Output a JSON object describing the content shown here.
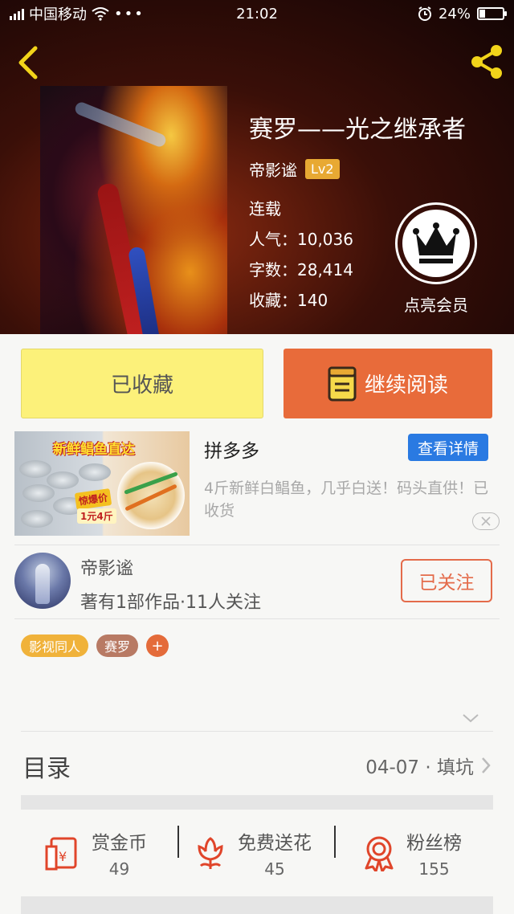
{
  "status_bar": {
    "carrier": "中国移动",
    "time": "21:02",
    "battery": "24%",
    "battery_level": 0.24
  },
  "book": {
    "title": "赛罗——光之继承者",
    "author": "帝影谧",
    "level": "Lv2",
    "status": "连载",
    "popularity_label": "人气：",
    "popularity": "10,036",
    "words_label": "字数：",
    "words": "28,414",
    "favorites_label": "收藏：",
    "favorites": "140"
  },
  "member": {
    "label": "点亮会员"
  },
  "actions": {
    "collected_label": "已收藏",
    "continue_label": "继续阅读"
  },
  "ad": {
    "image_title": "新鲜鲳鱼直达",
    "image_tag": "惊爆价",
    "image_price": "1元4斤",
    "title": "拼多多",
    "button": "查看详情",
    "description": "4斤新鲜白鲳鱼，几乎白送！码头直供！已收货"
  },
  "author_card": {
    "name": "帝影谧",
    "stats": "著有1部作品·11人关注",
    "follow_label": "已关注"
  },
  "tags": [
    {
      "label": "影视同人",
      "color": "#f0b23a"
    },
    {
      "label": "赛罗",
      "color": "#b87a64"
    }
  ],
  "tag_add": "+",
  "toc": {
    "label": "目录",
    "latest": "04-07 · 填坑"
  },
  "stats": [
    {
      "label": "赏金币",
      "value": "49",
      "icon": "red-envelope-icon"
    },
    {
      "label": "免费送花",
      "value": "45",
      "icon": "flower-icon"
    },
    {
      "label": "粉丝榜",
      "value": "155",
      "icon": "medal-icon"
    }
  ],
  "colors": {
    "accent": "#e86b3a",
    "collected": "#fcf17a",
    "ad_button": "#2a7ae2",
    "icon_red": "#e0452a"
  }
}
